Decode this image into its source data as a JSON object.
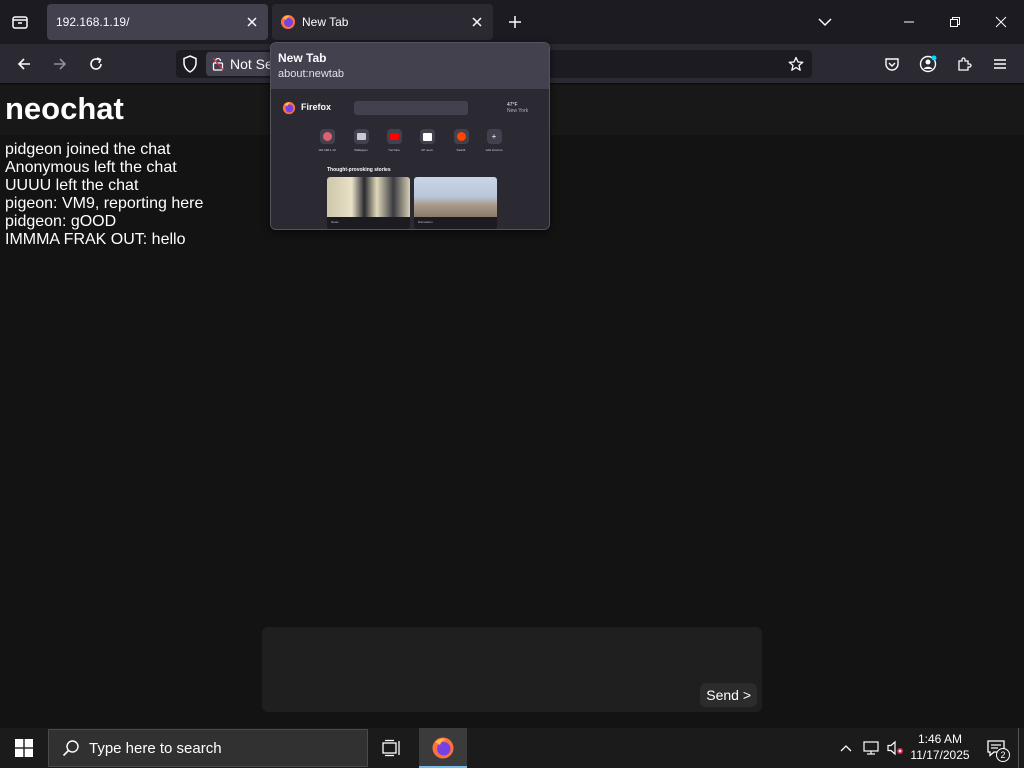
{
  "browser": {
    "tabs": [
      {
        "title": "192.168.1.19/",
        "active": true
      },
      {
        "title": "New Tab",
        "active": false
      }
    ],
    "address_bar": {
      "security_label": "Not Se"
    }
  },
  "tab_preview": {
    "title": "New Tab",
    "url": "about:newtab",
    "thumbnail": {
      "brand": "Firefox",
      "weather_temp": "47°F",
      "weather_loc": "New York",
      "shortcuts": [
        "192.168.1.19",
        "Wallpaper",
        "YouTube",
        "AP news",
        "Reddit",
        "Add shortcut"
      ],
      "stories_title": "Thought-provoking stories",
      "stories": [
        "News",
        "Discussion"
      ]
    }
  },
  "app": {
    "title": "neochat",
    "messages": [
      "pidgeon joined the chat",
      "Anonymous left the chat",
      "UUUU left the chat",
      "pigeon: VM9, reporting here",
      "pidgeon: gOOD",
      "IMMMA FRAK OUT: hello"
    ],
    "composer": {
      "value": "",
      "send_label": "Send >"
    }
  },
  "taskbar": {
    "search_placeholder": "Type here to search",
    "time": "1:46 AM",
    "date": "11/17/2025",
    "notification_count": "2"
  },
  "colors": {
    "page_bg": "#131313",
    "tab_active": "#42414d",
    "taskbar_bg": "#1b1b1b",
    "firefox_accent": "#ff7139"
  }
}
